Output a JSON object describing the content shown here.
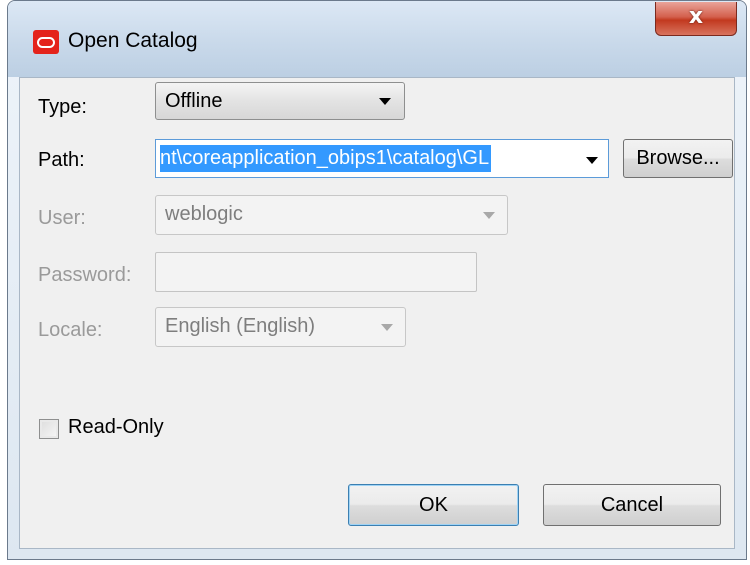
{
  "window": {
    "title": "Open Catalog",
    "close_label": "x"
  },
  "form": {
    "type": {
      "label": "Type:",
      "value": "Offline"
    },
    "path": {
      "label": "Path:",
      "value": "nt\\coreapplication_obips1\\catalog\\GL",
      "browse_label": "Browse..."
    },
    "user": {
      "label": "User:",
      "value": "weblogic"
    },
    "password": {
      "label": "Password:",
      "value": ""
    },
    "locale": {
      "label": "Locale:",
      "value": "English (English)"
    },
    "read_only": {
      "label": "Read-Only",
      "checked": false
    }
  },
  "buttons": {
    "ok_label": "OK",
    "cancel_label": "Cancel"
  },
  "colors": {
    "selection": "#3399ff",
    "close_button": "#c2391f",
    "oracle_logo": "#e4231b"
  },
  "icons": {
    "app": "oracle-logo-icon",
    "dropdown": "chevron-down-icon"
  }
}
